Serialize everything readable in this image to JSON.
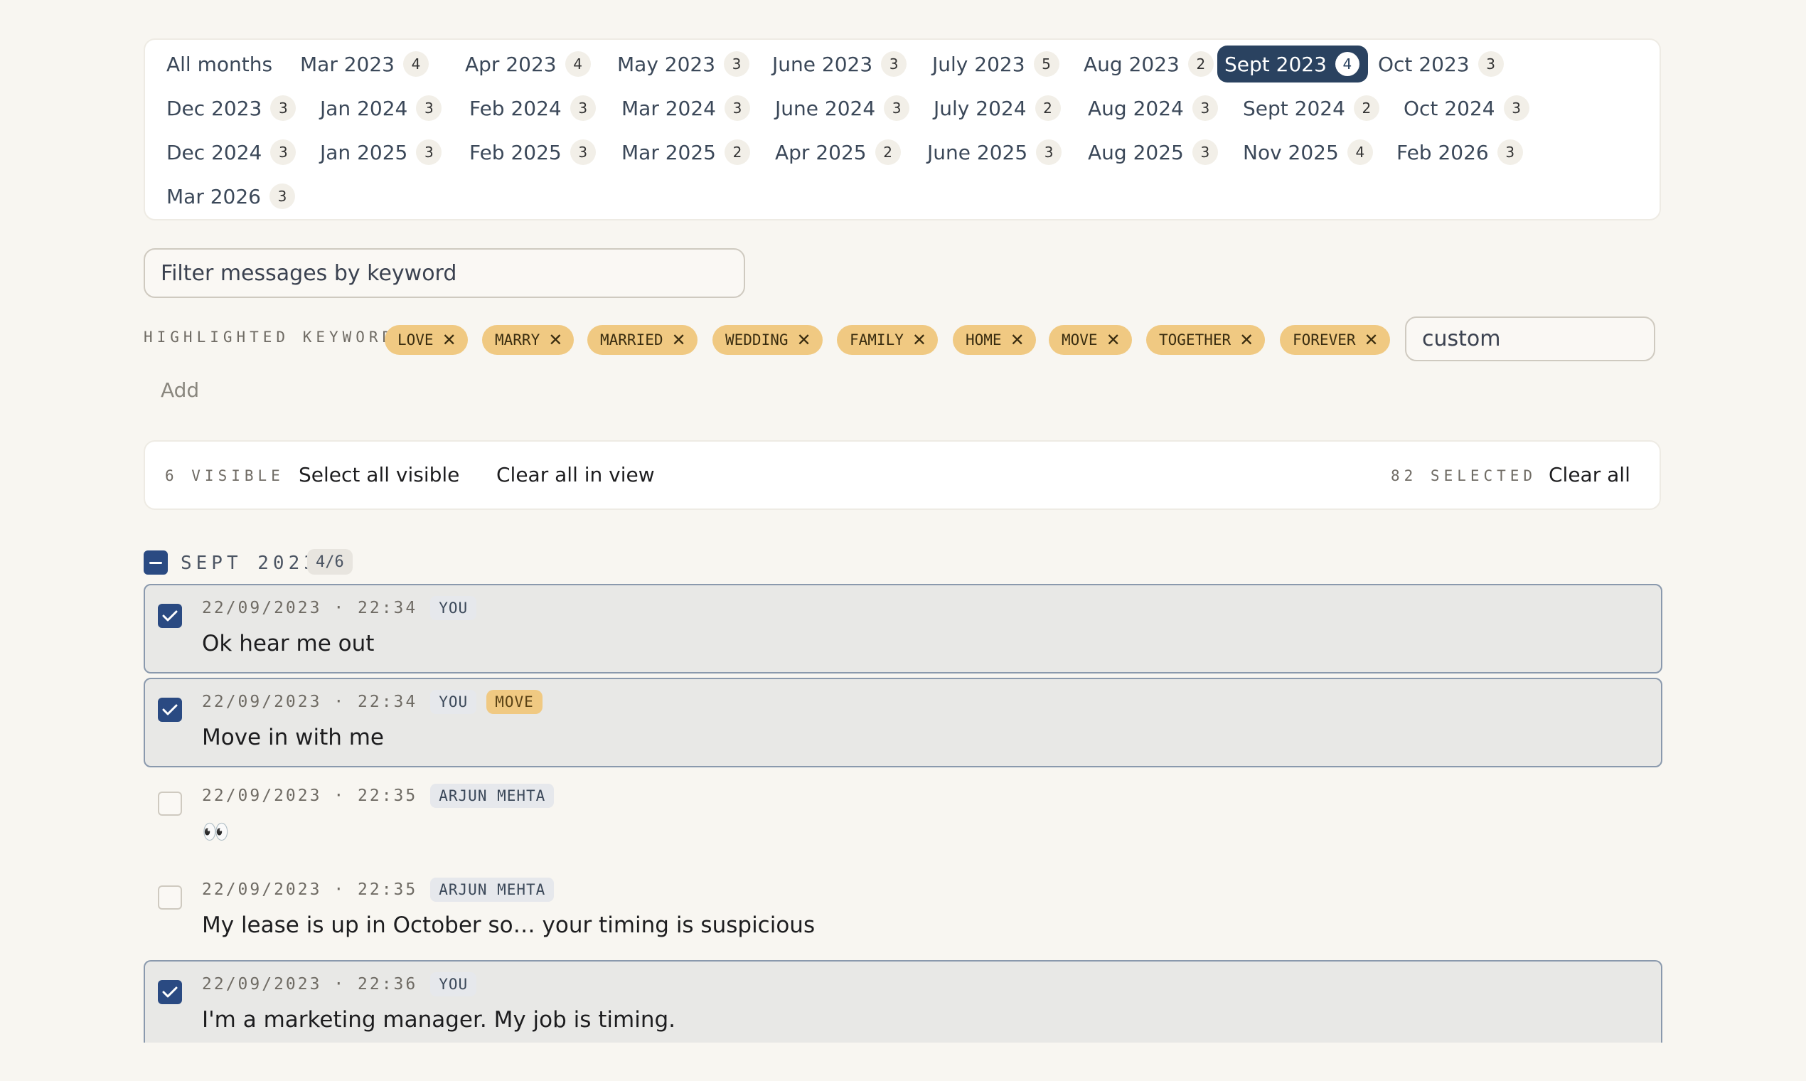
{
  "months": [
    {
      "label": "All months",
      "count": ""
    },
    {
      "label": "Mar 2023",
      "count": "4"
    },
    {
      "label": "Apr 2023",
      "count": "4"
    },
    {
      "label": "May 2023",
      "count": "3"
    },
    {
      "label": "June 2023",
      "count": "3"
    },
    {
      "label": "July 2023",
      "count": "5"
    },
    {
      "label": "Aug 2023",
      "count": "2"
    },
    {
      "label": "Sept 2023",
      "count": "4",
      "active": true
    },
    {
      "label": "Oct 2023",
      "count": "3"
    },
    {
      "label": "Dec 2023",
      "count": "3"
    },
    {
      "label": "Jan 2024",
      "count": "3"
    },
    {
      "label": "Feb 2024",
      "count": "3"
    },
    {
      "label": "Mar 2024",
      "count": "3"
    },
    {
      "label": "June 2024",
      "count": "3"
    },
    {
      "label": "July 2024",
      "count": "2"
    },
    {
      "label": "Aug 2024",
      "count": "3"
    },
    {
      "label": "Sept 2024",
      "count": "2"
    },
    {
      "label": "Oct 2024",
      "count": "3"
    },
    {
      "label": "Dec 2024",
      "count": "3"
    },
    {
      "label": "Jan 2025",
      "count": "3"
    },
    {
      "label": "Feb 2025",
      "count": "3"
    },
    {
      "label": "Mar 2025",
      "count": "2"
    },
    {
      "label": "Apr 2025",
      "count": "2"
    },
    {
      "label": "June 2025",
      "count": "3"
    },
    {
      "label": "Aug 2025",
      "count": "3"
    },
    {
      "label": "Nov 2025",
      "count": "4"
    },
    {
      "label": "Feb 2026",
      "count": "3"
    },
    {
      "label": "Mar 2026",
      "count": "3"
    }
  ],
  "filter": {
    "placeholder": "Filter messages by keyword"
  },
  "keywords": {
    "label": "HIGHLIGHTED KEYWORDS",
    "chips": [
      "LOVE",
      "MARRY",
      "MARRIED",
      "WEDDING",
      "FAMILY",
      "HOME",
      "MOVE",
      "TOGETHER",
      "FOREVER"
    ],
    "remove_glyph": "✕",
    "custom_placeholder": "custom",
    "add_label": "Add"
  },
  "selection_bar": {
    "visible": "6 VISIBLE",
    "select_all": "Select all visible",
    "clear_view": "Clear all in view",
    "selected": "82 SELECTED",
    "clear_all": "Clear all"
  },
  "group": {
    "title": "SEPT 2023",
    "badge": "4/6"
  },
  "messages": [
    {
      "timestamp": "22/09/2023 · 22:34",
      "sender": "YOU",
      "keyword": "",
      "text": "Ok hear me out",
      "selected": true
    },
    {
      "timestamp": "22/09/2023 · 22:34",
      "sender": "YOU",
      "keyword": "MOVE",
      "text": "Move in with me",
      "selected": true
    },
    {
      "timestamp": "22/09/2023 · 22:35",
      "sender": "ARJUN MEHTA",
      "keyword": "",
      "text": "👀",
      "selected": false
    },
    {
      "timestamp": "22/09/2023 · 22:35",
      "sender": "ARJUN MEHTA",
      "keyword": "",
      "text": "My lease is up in October so… your timing is suspicious",
      "selected": false
    },
    {
      "timestamp": "22/09/2023 · 22:36",
      "sender": "YOU",
      "keyword": "",
      "text": "I'm a marketing manager. My job is timing.",
      "selected": true
    }
  ],
  "colors": {
    "accent": "#2a4260",
    "checkbox": "#2a4a82",
    "keyword_chip": "#f0c982",
    "background": "#f8f6f1"
  }
}
